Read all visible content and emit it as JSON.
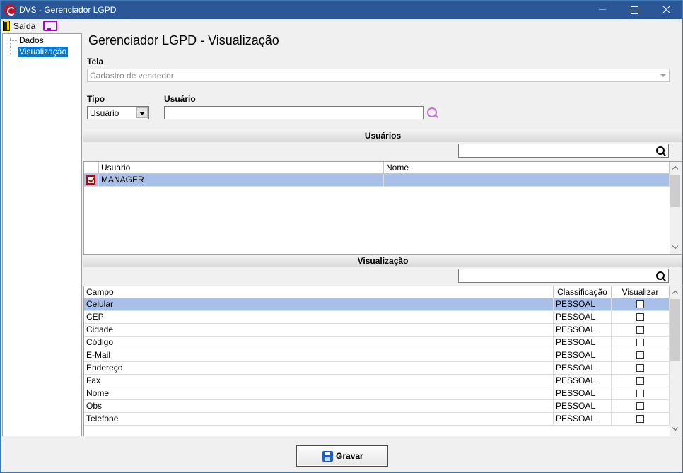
{
  "window": {
    "title": "DVS - Gerenciador LGPD"
  },
  "menu": {
    "exit_label": "Saída"
  },
  "tree": {
    "items": [
      "Dados",
      "Visualização"
    ]
  },
  "page": {
    "title": "Gerenciador LGPD - Visualização"
  },
  "form": {
    "tela_label": "Tela",
    "tela_value": "Cadastro de vendedor",
    "tipo_label": "Tipo",
    "tipo_value": "Usuário",
    "usuario_label": "Usuário",
    "usuario_value": ""
  },
  "usuarios": {
    "header": "Usuários",
    "filter_value": "",
    "columns": [
      "Usuário",
      "Nome"
    ],
    "rows": [
      {
        "checked": true,
        "usuario": "MANAGER",
        "nome": ""
      }
    ]
  },
  "visualizacao": {
    "header": "Visualização",
    "filter_value": "",
    "columns": [
      "Campo",
      "Classificação",
      "Visualizar"
    ],
    "rows": [
      {
        "campo": "Celular",
        "classificacao": "PESSOAL",
        "visualizar": false
      },
      {
        "campo": "CEP",
        "classificacao": "PESSOAL",
        "visualizar": false
      },
      {
        "campo": "Cidade",
        "classificacao": "PESSOAL",
        "visualizar": false
      },
      {
        "campo": "Código",
        "classificacao": "PESSOAL",
        "visualizar": false
      },
      {
        "campo": "E-Mail",
        "classificacao": "PESSOAL",
        "visualizar": false
      },
      {
        "campo": "Endereço",
        "classificacao": "PESSOAL",
        "visualizar": false
      },
      {
        "campo": "Fax",
        "classificacao": "PESSOAL",
        "visualizar": false
      },
      {
        "campo": "Nome",
        "classificacao": "PESSOAL",
        "visualizar": false
      },
      {
        "campo": "Obs",
        "classificacao": "PESSOAL",
        "visualizar": false
      },
      {
        "campo": "Telefone",
        "classificacao": "PESSOAL",
        "visualizar": false
      }
    ]
  },
  "footer": {
    "save_hotkey": "G",
    "save_rest": "ravar"
  },
  "colors": {
    "titlebar": "#2b5797",
    "selection": "#a8c0e8",
    "tree_selection": "#0078d7"
  }
}
